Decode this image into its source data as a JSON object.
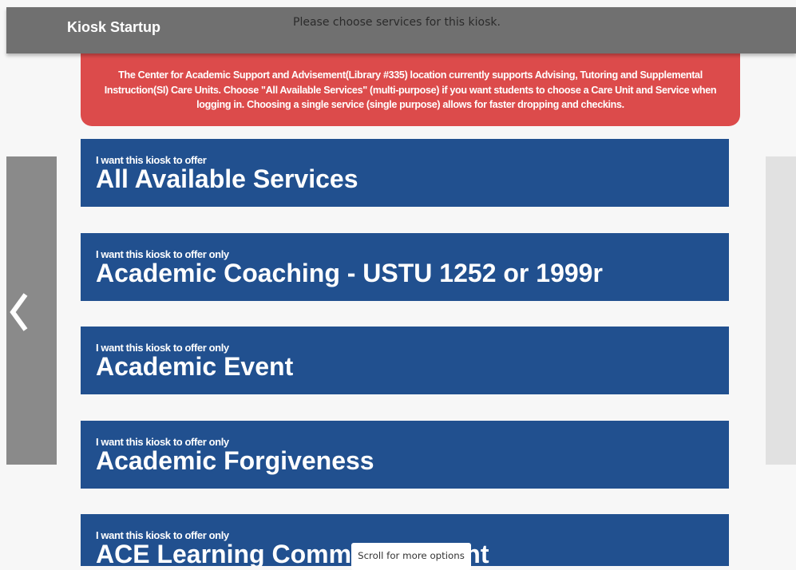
{
  "header": {
    "title": "Kiosk Startup",
    "subtitle": "Please choose services for this kiosk."
  },
  "notice": {
    "text": "The Center for Academic Support and Advisement(Library #335) location currently supports Advising, Tutoring and Supplemental Instruction(SI) Care Units. Choose \"All Available Services\" (multi-purpose) if you want students to choose a Care Unit and Service when logging in. Choosing a single service (single purpose) allows for faster dropping and checkins."
  },
  "services": [
    {
      "prefix": "I want this kiosk to offer",
      "name": "All Available Services"
    },
    {
      "prefix": "I want this kiosk to offer only",
      "name": "Academic Coaching - USTU 1252 or 1999r"
    },
    {
      "prefix": "I want this kiosk to offer only",
      "name": "Academic Event"
    },
    {
      "prefix": "I want this kiosk to offer only",
      "name": "Academic Forgiveness"
    },
    {
      "prefix": "I want this kiosk to offer only",
      "name": "ACE Learning Community Event"
    }
  ],
  "nav": {
    "prev_icon": "chevron-left-icon"
  },
  "scroll_hint": "Scroll for more options",
  "colors": {
    "header_bg": "#707070",
    "notice_bg": "#dc4b4b",
    "service_bg": "#21508f",
    "nav_left_bg": "#8a8a8a",
    "nav_right_bg": "#e1e1e1",
    "page_bg": "#f7f7f7"
  }
}
